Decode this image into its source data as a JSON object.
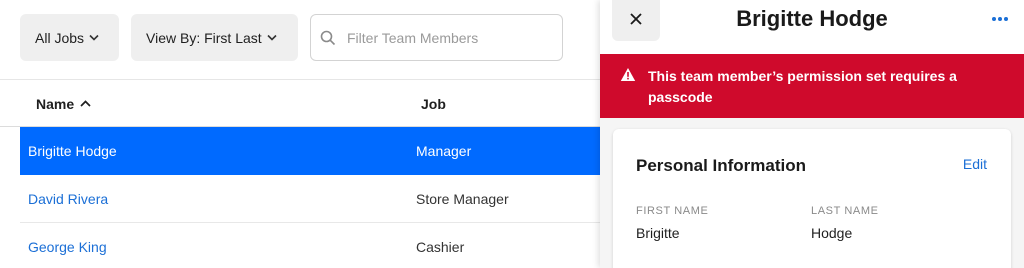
{
  "toolbar": {
    "jobs_filter": "All Jobs",
    "view_by": "View By: First Last",
    "search_placeholder": "Filter Team Members"
  },
  "table": {
    "columns": {
      "name": "Name",
      "job": "Job"
    },
    "rows": [
      {
        "name": "Brigitte Hodge",
        "job": "Manager",
        "selected": true
      },
      {
        "name": "David Rivera",
        "job": "Store Manager",
        "selected": false
      },
      {
        "name": "George King",
        "job": "Cashier",
        "selected": false
      }
    ]
  },
  "panel": {
    "title": "Brigitte Hodge",
    "alert": "This team member’s permission set requires a passcode",
    "section_title": "Personal Information",
    "edit_label": "Edit",
    "fields": [
      {
        "label": "FIRST NAME",
        "value": "Brigitte"
      },
      {
        "label": "LAST NAME",
        "value": "Hodge"
      }
    ]
  },
  "colors": {
    "accent": "#006aff",
    "link": "#1b6fd6",
    "alert_bg": "#cf0a2c"
  },
  "icons": [
    "chevron-down-icon",
    "search-icon",
    "sort-ascending-icon",
    "close-icon",
    "more-horizontal-icon",
    "warning-icon"
  ]
}
